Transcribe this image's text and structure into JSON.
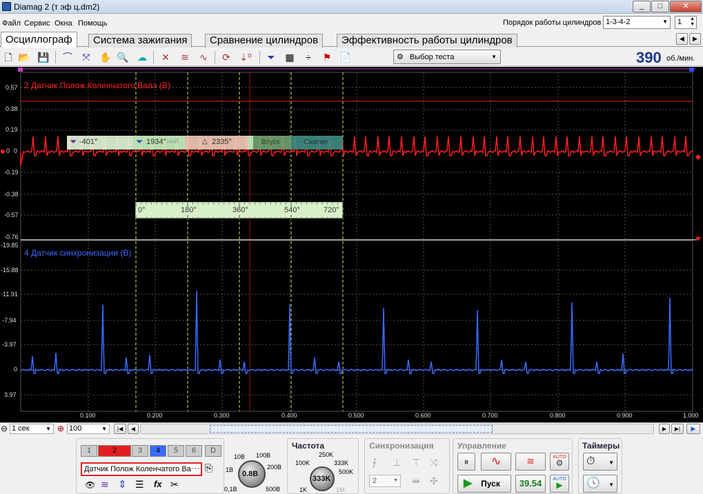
{
  "window": {
    "title": "Diamag 2 (т эф ц.dm2)",
    "minimize": "_",
    "maximize": "□",
    "close": "✕"
  },
  "menu": [
    "Файл",
    "Сервис",
    "Окна",
    "Помощь"
  ],
  "firing_order": {
    "label": "Порядок работы цилиндров",
    "value": "1-3-4-2",
    "cyl_value": "1"
  },
  "tabs": [
    "Осциллограф",
    "Система зажигания",
    "Сравнение цилиндров",
    "Эффективность работы цилиндров"
  ],
  "toolbar": {
    "test_select": "Выбор теста",
    "rpm_value": "390",
    "rpm_unit": "об./мин."
  },
  "channel_top": {
    "title": "2 Датчик Полож Коленчатого Вала (В)",
    "color": "#ff2020",
    "y_ticks": [
      "0.57",
      "0.38",
      "0.19",
      "0",
      "-0.19",
      "-0.38",
      "-0.57",
      "-0.76"
    ],
    "zero_label": "0"
  },
  "channel_bottom": {
    "title": "4 Датчик синхронизации (В)",
    "color": "#3a6bff",
    "y_ticks": [
      "-19.85",
      "-15.88",
      "-11.91",
      "-7.94",
      "-3.97",
      "0",
      "3.97"
    ]
  },
  "markers": {
    "m1": "-401°",
    "m2": "1934°",
    "delta": "2335°",
    "phase_partial": "ний",
    "intake": "Впуск",
    "compression": "Сжатие"
  },
  "degree_scale": [
    "0°",
    "180°",
    "360°",
    "540°",
    "720°"
  ],
  "x_ticks": [
    "0.100",
    "0.200",
    "0.300",
    "0.400",
    "0.500",
    "0.600",
    "0.700",
    "0.800",
    "0.900",
    "1.000"
  ],
  "timebase": {
    "value": "1 сек",
    "zoom": "100"
  },
  "channels": {
    "buttons": [
      "1",
      "2",
      "3",
      "4",
      "5",
      "6",
      "D"
    ],
    "sensor_name": "Датчик Полож Коленчатого Ва"
  },
  "amplitude": {
    "labels": [
      "10В",
      "100В",
      "1В",
      "200В",
      "0,1В",
      "500В"
    ],
    "value": "0.8В"
  },
  "frequency": {
    "title": "Частота",
    "labels": [
      "250K",
      "100K",
      "333K",
      "500K",
      "1K",
      "1M"
    ],
    "value": "333K"
  },
  "sync": {
    "title": "Синхронизация",
    "value": "2"
  },
  "control": {
    "title": "Управление",
    "start": "Пуск",
    "counter": "39.54",
    "auto": "AUTO"
  },
  "timers": {
    "title": "Таймеры"
  },
  "colors": {
    "red": "#ff2020",
    "blue": "#3a6bff",
    "yellow_grid": "#e8e060",
    "green": "#1a9a1a"
  }
}
